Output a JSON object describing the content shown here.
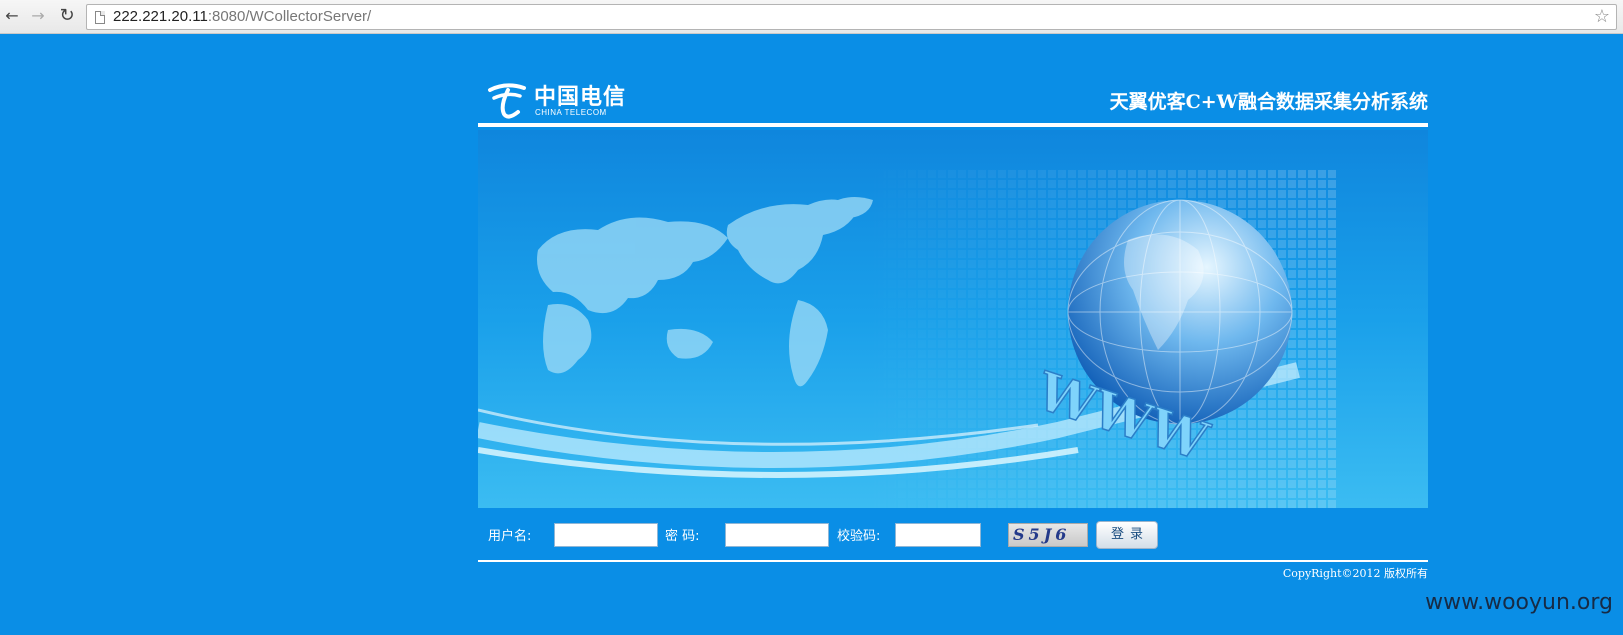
{
  "browser": {
    "url_host": "222.221.20.11",
    "url_rest": ":8080/WCollectorServer/",
    "icons": [
      "back-arrow-icon",
      "forward-arrow-icon",
      "reload-icon",
      "page-icon",
      "bookmark-star-icon"
    ]
  },
  "header": {
    "logo_cn": "中国电信",
    "logo_en": "CHINA TELECOM",
    "system_title": "天翼优客C+W融合数据采集分析系统"
  },
  "banner": {
    "www_text": "WWW"
  },
  "login": {
    "username_label": "用户名:",
    "username_value": "",
    "password_label": "密 码:",
    "password_value": "",
    "captcha_label": "校验码:",
    "captcha_value": "",
    "captcha_image_text": "S5J6",
    "submit_label": "登录"
  },
  "footer": {
    "copyright": "CopyRight©2012  版权所有"
  },
  "watermark": "www.wooyun.org",
  "colors": {
    "page_bg": "#0a8ee6",
    "banner_top": "#0f86dd",
    "banner_bottom": "#3bbcf2"
  }
}
